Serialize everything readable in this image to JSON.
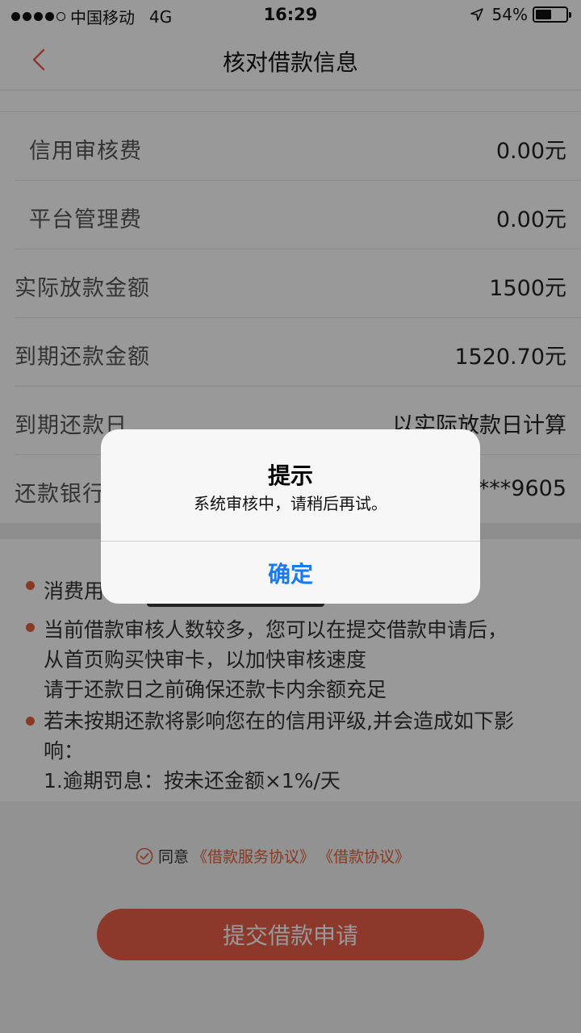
{
  "status_bar": {
    "carrier": "中国移动",
    "network": "4G",
    "time": "16:29",
    "battery": "54%",
    "battery_level": 0.54
  },
  "nav": {
    "title": "核对借款信息",
    "back_icon": "chevron-left-icon"
  },
  "rows": [
    {
      "label": "信用审核费",
      "value": "0.00元"
    },
    {
      "label": "平台管理费",
      "value": "0.00元"
    },
    {
      "label": "实际放款金额",
      "value": "1500元"
    },
    {
      "label": "到期还款金额",
      "value": "1520.70元"
    },
    {
      "label": "到期还款日",
      "value": "以实际放款日计算"
    },
    {
      "label": "还款银行",
      "value": "***9605"
    }
  ],
  "notes": {
    "item1": "消费用",
    "item2_lines": [
      "当前借款审核人数较多，您可以在提交借款申请后，",
      "从首页购买快审卡，以加快审核速度",
      "请于还款日之前确保还款卡内余额充足"
    ],
    "item3_lines": [
      "若未按期还款将影响您在的信用评级,并会造成如下影",
      "响：",
      "1.逾期罚息：按未还金额×1%/天"
    ]
  },
  "agreement": {
    "prefix": "同意",
    "link1": "《借款服务协议》",
    "link2": "《借款协议》"
  },
  "submit_label": "提交借款申请",
  "alert": {
    "title": "提示",
    "message": "系统审核中，请稍后再试。",
    "confirm": "确定"
  },
  "colors": {
    "accent": "#e9604a",
    "link": "#e2623f",
    "ios_blue": "#1a7af0"
  }
}
